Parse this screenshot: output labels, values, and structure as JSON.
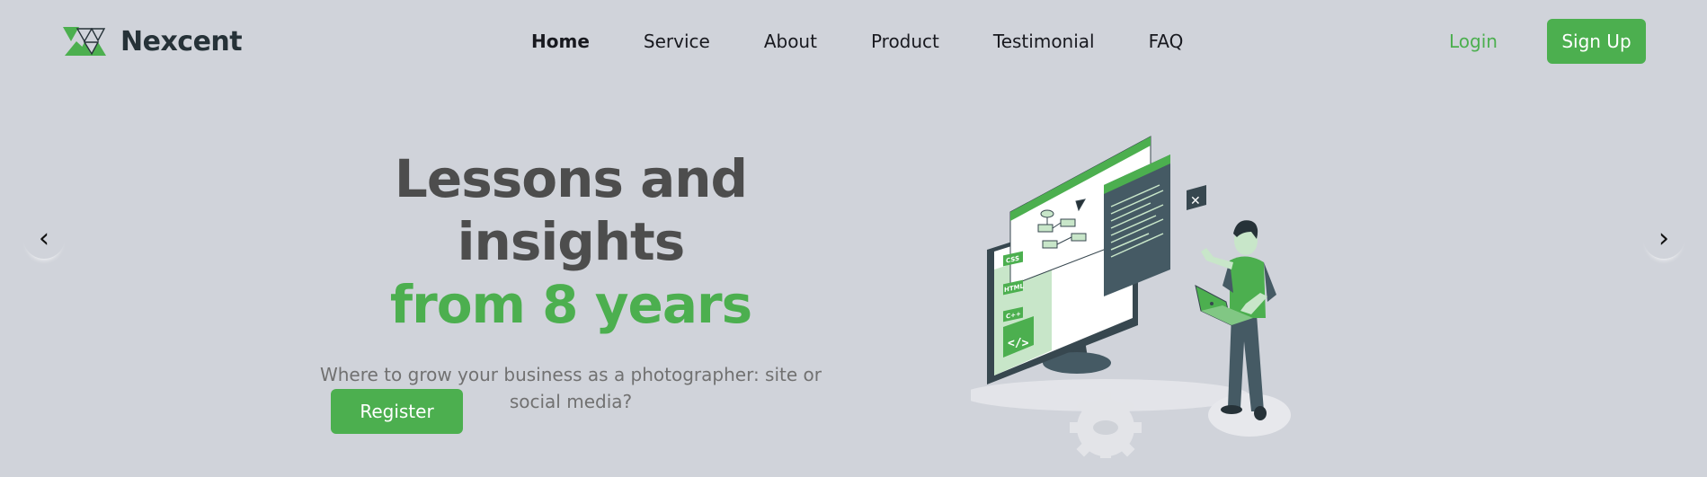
{
  "brand": {
    "name": "Nexcent",
    "accent": "#4caf4f",
    "dark": "#263238"
  },
  "nav": {
    "items": [
      {
        "label": "Home"
      },
      {
        "label": "Service"
      },
      {
        "label": "About"
      },
      {
        "label": "Product"
      },
      {
        "label": "Testimonial"
      },
      {
        "label": "FAQ"
      }
    ],
    "active": "Home"
  },
  "auth": {
    "login_label": "Login",
    "signup_label": "Sign Up"
  },
  "carousel": {
    "prev_symbol": "‹",
    "next_symbol": "›"
  },
  "hero": {
    "title_line1": "Lessons and insights",
    "title_line2": "from 8 years",
    "subtitle": "Where to grow your business as a photographer: site or social media?",
    "cta_label": "Register"
  },
  "illustration": {
    "code_tags": [
      "CSS",
      "HTML",
      "C++"
    ],
    "code_icon": "</>",
    "close_mark": "✕"
  }
}
